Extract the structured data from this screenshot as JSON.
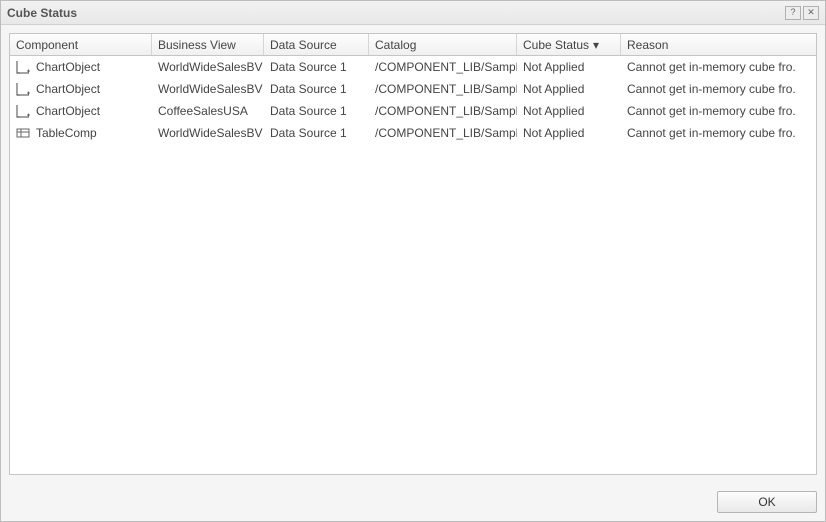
{
  "dialog": {
    "title": "Cube Status"
  },
  "columns": {
    "component": "Component",
    "business_view": "Business View",
    "data_source": "Data Source",
    "catalog": "Catalog",
    "cube_status": "Cube Status",
    "reason": "Reason"
  },
  "rows": [
    {
      "icon": "chart-icon",
      "component": "ChartObject",
      "business_view": "WorldWideSalesBV",
      "data_source": "Data Source 1",
      "catalog": "/COMPONENT_LIB/Sampl.",
      "cube_status": "Not Applied",
      "reason": "Cannot get in-memory cube fro."
    },
    {
      "icon": "chart-icon",
      "component": "ChartObject",
      "business_view": "WorldWideSalesBV",
      "data_source": "Data Source 1",
      "catalog": "/COMPONENT_LIB/Sampl.",
      "cube_status": "Not Applied",
      "reason": "Cannot get in-memory cube fro."
    },
    {
      "icon": "chart-icon",
      "component": "ChartObject",
      "business_view": "CoffeeSalesUSA",
      "data_source": "Data Source 1",
      "catalog": "/COMPONENT_LIB/Sampl.",
      "cube_status": "Not Applied",
      "reason": "Cannot get in-memory cube fro."
    },
    {
      "icon": "table-icon",
      "component": "TableComp",
      "business_view": "WorldWideSalesBV",
      "data_source": "Data Source 1",
      "catalog": "/COMPONENT_LIB/Sampl.",
      "cube_status": "Not Applied",
      "reason": "Cannot get in-memory cube fro."
    }
  ],
  "buttons": {
    "ok": "OK"
  },
  "titlebar_icons": {
    "help": "?",
    "close": "✕"
  },
  "sort": {
    "column": "cube_status",
    "dir_glyph": "▾"
  }
}
